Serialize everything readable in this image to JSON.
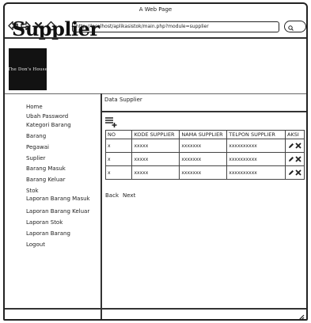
{
  "window": {
    "title": "A Web Page"
  },
  "browser": {
    "url": "http://localhost/aplikasistok/main.php?module=supplier",
    "search_placeholder": ""
  },
  "page": {
    "heading": "Supplier"
  },
  "logo": {
    "text": "The Don's House"
  },
  "sidebar": {
    "items": [
      {
        "label": "Home"
      },
      {
        "label": "Ubah Password"
      },
      {
        "label": "Kategori Barang"
      },
      {
        "label": "Barang"
      },
      {
        "label": "Pegawai"
      },
      {
        "label": "Suplier"
      },
      {
        "label": "Barang Masuk"
      },
      {
        "label": "Barang Keluar"
      },
      {
        "label": "Stok"
      },
      {
        "label": "Laporan Barang Masuk"
      },
      {
        "label": "Laporan Barang Keluar"
      },
      {
        "label": "Laporan Stok"
      },
      {
        "label": "Laporan Barang"
      },
      {
        "label": "Logout"
      }
    ]
  },
  "main": {
    "section_title": "Data Supplier",
    "table": {
      "headers": [
        "NO",
        "KODE SUPPLIER",
        "NAMA SUPPLIER",
        "TELPON SUPPLIER",
        "AKSI"
      ],
      "rows": [
        [
          "x",
          "xxxxx",
          "xxxxxxx",
          "xxxxxxxxxx"
        ],
        [
          "x",
          "xxxxx",
          "xxxxxxx",
          "xxxxxxxxxx"
        ],
        [
          "x",
          "xxxxx",
          "xxxxxxx",
          "xxxxxxxxxx"
        ]
      ]
    },
    "pager": {
      "back": "Back",
      "next": "Next"
    }
  },
  "icons": {
    "back": "back-arrow-icon",
    "forward": "forward-arrow-icon",
    "stop": "close-icon",
    "home": "home-icon",
    "search": "search-icon",
    "add": "add-list-icon",
    "edit": "pencil-icon",
    "delete": "delete-icon"
  }
}
